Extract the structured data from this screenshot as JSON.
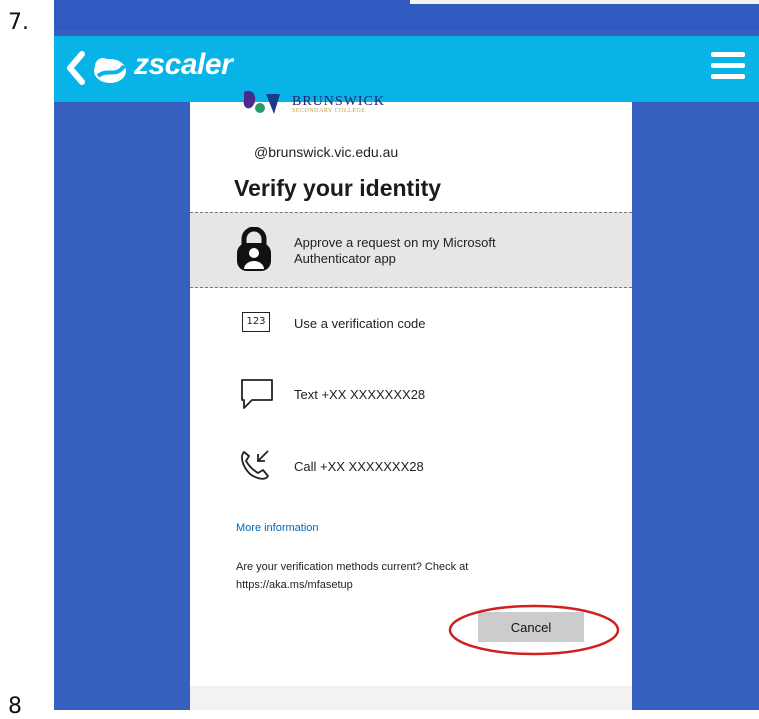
{
  "steps": {
    "current": "7.",
    "next": "8"
  },
  "topbar": {
    "brand": "zscaler",
    "back_icon": "chevron-left-icon",
    "logo_icon": "zscaler-cloud-icon",
    "menu_icon": "hamburger-menu-icon"
  },
  "org": {
    "name": "BRUNSWICK",
    "subtitle": "SECONDARY COLLEGE"
  },
  "account": {
    "email": "@brunswick.vic.edu.au"
  },
  "page": {
    "title": "Verify your identity"
  },
  "options": [
    {
      "label": "Approve a request on my Microsoft Authenticator app",
      "icon": "authenticator-lock-icon",
      "selected": true
    },
    {
      "label": "Use a verification code",
      "icon": "code-123-icon",
      "icon_text": "123"
    },
    {
      "label": "Text +XX XXXXXXX28",
      "icon": "sms-bubble-icon"
    },
    {
      "label": "Call +XX XXXXXXX28",
      "icon": "phone-call-icon"
    }
  ],
  "links": {
    "more_info": "More information"
  },
  "note": "Are your verification methods current? Check at https://aka.ms/mfasetup",
  "buttons": {
    "cancel": "Cancel"
  },
  "colors": {
    "zscaler_bar": "#08b3e8",
    "background": "#3560c0",
    "annotation": "#d11f1f",
    "link": "#0067b8"
  }
}
